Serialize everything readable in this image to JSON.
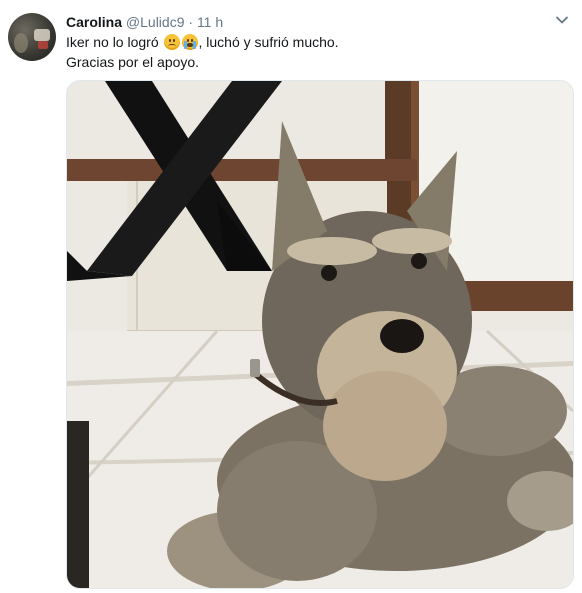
{
  "tweet": {
    "author_name": "Carolina",
    "handle": "@Lulidc9",
    "separator": "·",
    "time": "11 h",
    "text_line1_start": "Iker no lo logró ",
    "text_line1_end": ", luchó y sufrió mucho.",
    "text_line2": "Gracias por el apoyo."
  },
  "icons": {
    "menu": "chevron-down-icon",
    "emoji1": "sad-face-emoji",
    "emoji2": "crying-face-emoji"
  },
  "colors": {
    "name": "#14171a",
    "muted": "#657786",
    "text": "#14171a",
    "ribbon": "#111111"
  }
}
